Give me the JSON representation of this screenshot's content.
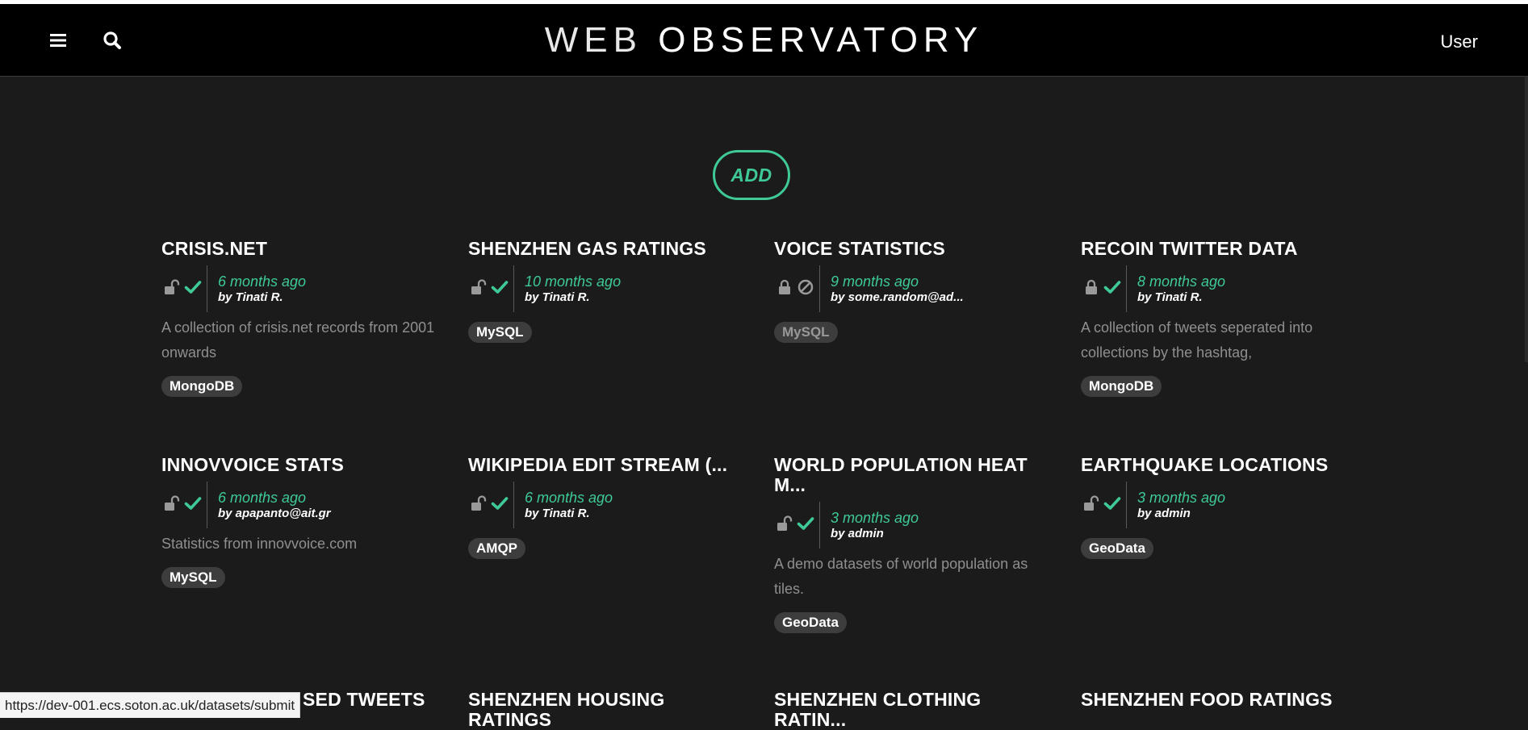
{
  "header": {
    "title_thin": "WEB",
    "title_bold": "OBSERVATORY",
    "user_label": "User"
  },
  "add_button_label": "ADD",
  "colors": {
    "accent": "#3ec996",
    "background": "#1b1b1b",
    "navbar": "#000000",
    "tag": "#3d3d3d"
  },
  "datasets": [
    {
      "title": "CRISIS.NET",
      "time": "6 months ago",
      "author": "by Tinati R.",
      "lock": "unlocked",
      "status": "check",
      "description": "A collection of crisis.net records from 2001 onwards",
      "tag": "MongoDB",
      "tag_dim": false
    },
    {
      "title": "SHENZHEN GAS RATINGS",
      "time": "10 months ago",
      "author": "by Tinati R.",
      "lock": "unlocked",
      "status": "check",
      "description": "",
      "tag": "MySQL",
      "tag_dim": false
    },
    {
      "title": "VOICE STATISTICS",
      "time": "9 months ago",
      "author": "by some.random@ad...",
      "lock": "locked",
      "status": "blocked",
      "description": "",
      "tag": "MySQL",
      "tag_dim": true
    },
    {
      "title": "RECOIN TWITTER DATA",
      "time": "8 months ago",
      "author": "by Tinati R.",
      "lock": "locked",
      "status": "check",
      "description": "A collection of tweets seperated into collections by the hashtag,",
      "tag": "MongoDB",
      "tag_dim": false
    },
    {
      "title": "INNOVVOICE STATS",
      "time": "6 months ago",
      "author": "by apapanto@ait.gr",
      "lock": "unlocked",
      "status": "check",
      "description": "Statistics from innovvoice.com",
      "tag": "MySQL",
      "tag_dim": false
    },
    {
      "title": "WIKIPEDIA EDIT STREAM (...",
      "time": "6 months ago",
      "author": "by Tinati R.",
      "lock": "unlocked",
      "status": "check",
      "description": "",
      "tag": "AMQP",
      "tag_dim": false
    },
    {
      "title": "WORLD POPULATION HEAT M...",
      "time": "3 months ago",
      "author": "by admin",
      "lock": "unlocked",
      "status": "check",
      "description": "A demo datasets of world population as tiles.",
      "tag": "GeoData",
      "tag_dim": false
    },
    {
      "title": "EARTHQUAKE LOCATIONS",
      "time": "3 months ago",
      "author": "by admin",
      "lock": "unlocked",
      "status": "check",
      "description": "",
      "tag": "GeoData",
      "tag_dim": false
    },
    {
      "title": "SED TWEETS",
      "time": "",
      "author": "",
      "lock": "",
      "status": "",
      "description": "",
      "tag": "",
      "tag_dim": false
    },
    {
      "title": "SHENZHEN HOUSING RATINGS",
      "time": "",
      "author": "",
      "lock": "",
      "status": "",
      "description": "",
      "tag": "",
      "tag_dim": false
    },
    {
      "title": "SHENZHEN CLOTHING RATIN...",
      "time": "",
      "author": "",
      "lock": "",
      "status": "",
      "description": "",
      "tag": "",
      "tag_dim": false
    },
    {
      "title": "SHENZHEN FOOD RATINGS",
      "time": "",
      "author": "",
      "lock": "",
      "status": "",
      "description": "",
      "tag": "",
      "tag_dim": false
    }
  ],
  "status_bar_url": "https://dev-001.ecs.soton.ac.uk/datasets/submit"
}
